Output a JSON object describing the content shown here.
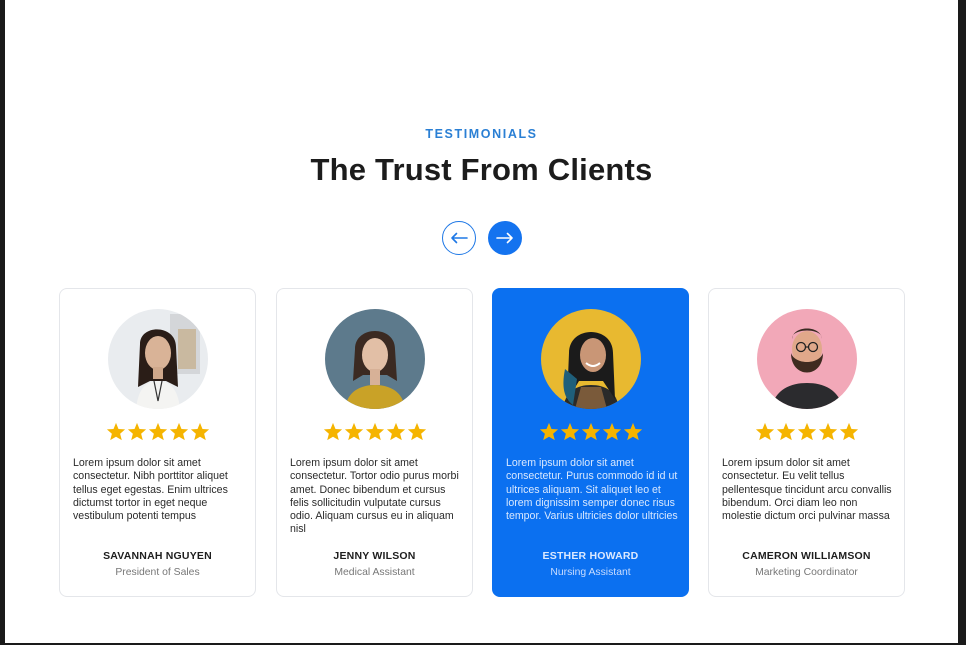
{
  "section": {
    "eyebrow": "TESTIMONIALS",
    "title": "The Trust From Clients"
  },
  "nav": {
    "prev_icon": "arrow-left-icon",
    "next_icon": "arrow-right-icon"
  },
  "colors": {
    "accent": "#1473ef",
    "star": "#f5b400",
    "active_card": "#0b70f0"
  },
  "testimonials": [
    {
      "rating": 5,
      "quote": "Lorem ipsum dolor sit amet consectetur. Nibh porttitor aliquet tellus eget egestas. Enim ultrices dictumst tortor in eget neque vestibulum potenti tempus",
      "name": "SAVANNAH NGUYEN",
      "role": "President of Sales"
    },
    {
      "rating": 5,
      "quote": "Lorem ipsum dolor sit amet consectetur. Tortor odio purus morbi amet. Donec bibendum et cursus felis sollicitudin vulputate cursus odio. Aliquam cursus eu in aliquam nisl",
      "name": "JENNY WILSON",
      "role": "Medical Assistant"
    },
    {
      "rating": 5,
      "quote": "Lorem ipsum dolor sit amet consectetur. Purus commodo id id ut ultrices aliquam. Sit aliquet leo et lorem dignissim semper donec risus tempor. Varius ultricies dolor ultricies",
      "name": "ESTHER HOWARD",
      "role": "Nursing Assistant"
    },
    {
      "rating": 5,
      "quote": "Lorem ipsum dolor sit amet consectetur. Eu velit tellus pellentesque tincidunt arcu convallis bibendum. Orci diam leo non molestie dictum orci pulvinar massa",
      "name": "CAMERON WILLIAMSON",
      "role": "Marketing Coordinator"
    }
  ]
}
